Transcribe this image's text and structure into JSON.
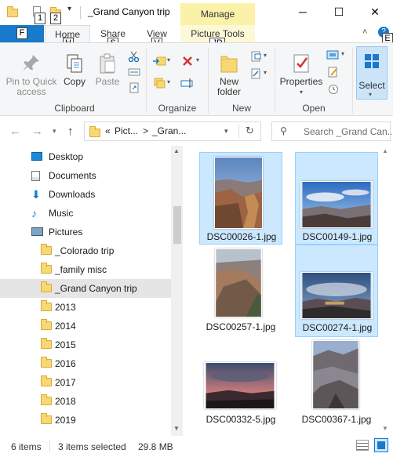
{
  "window": {
    "title": "_Grand Canyon trip",
    "context_tab": "Manage",
    "minimize_glyph": "─",
    "maximize_glyph": "☐",
    "close_glyph": "✕"
  },
  "keytips": {
    "qa1": "1",
    "qa2": "2",
    "file": "F",
    "home": "H",
    "share": "S",
    "view": "V",
    "picture_tools": "JP",
    "extra": "E"
  },
  "tabs": {
    "home": "Home",
    "share": "Share",
    "view": "View",
    "picture_tools": "Picture Tools"
  },
  "ribbon": {
    "clipboard": {
      "label": "Clipboard",
      "pin": "Pin to Quick access",
      "copy": "Copy",
      "paste": "Paste"
    },
    "organize": {
      "label": "Organize"
    },
    "new": {
      "label": "New",
      "new_folder": "New folder"
    },
    "open": {
      "label": "Open",
      "properties": "Properties"
    },
    "select": {
      "label": "Select"
    }
  },
  "address": {
    "crumb_chevron": "«",
    "crumb1": "Pict...",
    "crumb_sep": ">",
    "crumb2": "_Gran...",
    "search_placeholder": "Search _Grand Can..."
  },
  "nav_tree": [
    {
      "label": "Desktop",
      "icon": "desktop-icon"
    },
    {
      "label": "Documents",
      "icon": "documents-icon"
    },
    {
      "label": "Downloads",
      "icon": "downloads-icon"
    },
    {
      "label": "Music",
      "icon": "music-icon"
    },
    {
      "label": "Pictures",
      "icon": "pictures-icon"
    },
    {
      "label": "_Colorado trip",
      "icon": "folder-icon"
    },
    {
      "label": "_family misc",
      "icon": "folder-icon"
    },
    {
      "label": "_Grand Canyon trip",
      "icon": "folder-icon",
      "selected": true
    },
    {
      "label": "2013",
      "icon": "folder-icon"
    },
    {
      "label": "2014",
      "icon": "folder-icon"
    },
    {
      "label": "2015",
      "icon": "folder-icon"
    },
    {
      "label": "2016",
      "icon": "folder-icon"
    },
    {
      "label": "2017",
      "icon": "folder-icon"
    },
    {
      "label": "2018",
      "icon": "folder-icon"
    },
    {
      "label": "2019",
      "icon": "folder-icon"
    }
  ],
  "files": [
    {
      "name": "DSC00026-1.jpg",
      "selected": true
    },
    {
      "name": "DSC00149-1.jpg",
      "selected": true
    },
    {
      "name": "DSC00257-1.jpg",
      "selected": false
    },
    {
      "name": "DSC00274-1.jpg",
      "selected": true
    },
    {
      "name": "DSC00332-5.jpg",
      "selected": false
    },
    {
      "name": "DSC00367-1.jpg",
      "selected": false
    }
  ],
  "status": {
    "item_count": "6 items",
    "selection": "3 items selected",
    "size": "29.8 MB"
  },
  "colors": {
    "file_tab": "#1979ca",
    "manage_tab": "#fbf1a8",
    "selection_bg": "#cce8ff",
    "selection_border": "#99d1ff",
    "folder_yellow": "#f8d775"
  }
}
